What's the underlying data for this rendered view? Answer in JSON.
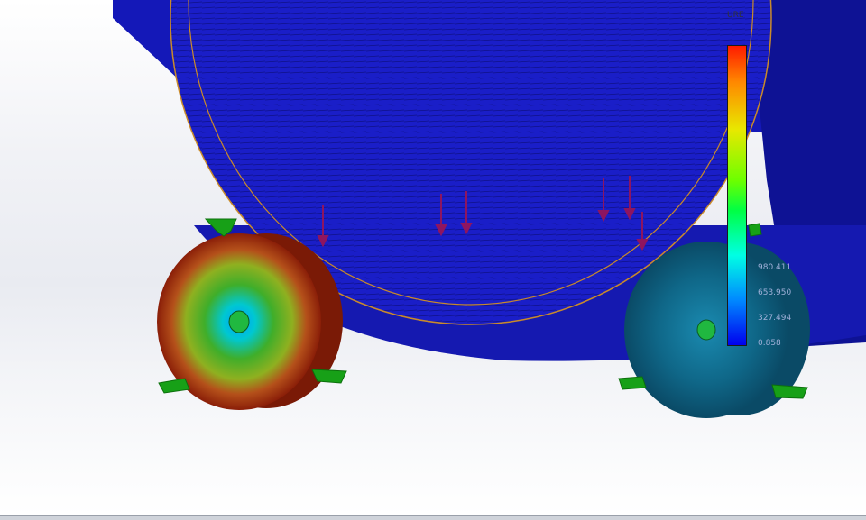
{
  "legend": {
    "title": "URE",
    "labels": [
      "980.411",
      "653.950",
      "327.494",
      "0.858"
    ]
  },
  "colors": {
    "tank_fill": "#1a1ec8",
    "tank_dark": "#0d118f",
    "tank_edge_line": "#c98a2a",
    "load_arrow": "#8e1560",
    "fixture": "#17a017",
    "wheel_left_outer": "#8a2a0a",
    "wheel_right_face": "#0d5c7a"
  }
}
